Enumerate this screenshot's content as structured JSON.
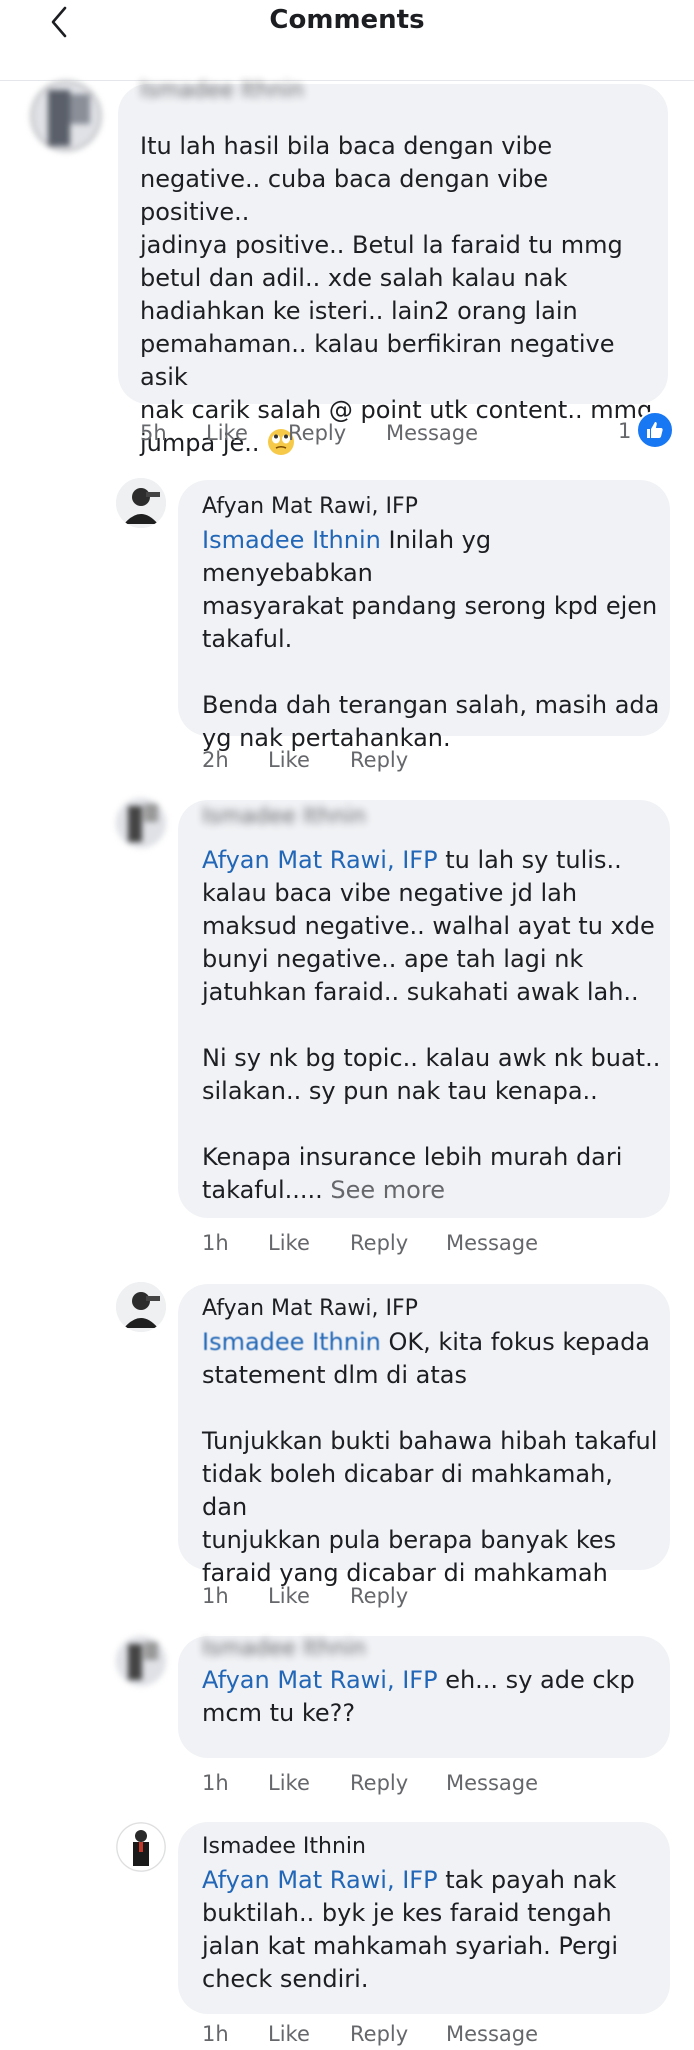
{
  "header": {
    "title": "Comments"
  },
  "comments": [
    {
      "author": "Ismadee Ithnin",
      "mention": "",
      "text": "Itu lah hasil bila baca dengan vibe\nnegative.. cuba baca dengan vibe positive..\njadinya positive.. Betul la faraid tu mmg\nbetul dan adil.. xde salah kalau nak\nhadiahkan ke isteri.. lain2 orang lain\npemahaman.. kalau berfikiran negative asik\nnak carik salah @ point utk content.. mmg\njumpa je..",
      "emoji": "rolling-eyes-emoji",
      "time": "5h",
      "like": "Like",
      "reply": "Reply",
      "message": "Message",
      "reaction_count": "1"
    },
    {
      "author": "Afyan Mat Rawi, IFP",
      "mention": "Ismadee Ithnin",
      "text": " Inilah yg menyebabkan\nmasyarakat pandang serong kpd ejen\ntakaful.\n\nBenda dah terangan salah, masih ada\nyg nak pertahankan.",
      "time": "2h",
      "like": "Like",
      "reply": "Reply"
    },
    {
      "author": "Ismadee Ithnin",
      "mention": "Afyan Mat Rawi, IFP",
      "text": " tu lah sy tulis..\nkalau baca vibe negative jd lah\nmaksud negative.. walhal ayat tu xde\nbunyi negative.. ape tah lagi nk\njatuhkan faraid.. sukahati awak lah..\n\nNi sy nk bg topic.. kalau awk nk buat..\nsilakan.. sy pun nak tau kenapa..\n\nKenapa insurance lebih murah dari\ntakaful.....",
      "see_more": " See more",
      "time": "1h",
      "like": "Like",
      "reply": "Reply",
      "message": "Message"
    },
    {
      "author": "Afyan Mat Rawi, IFP",
      "mention": "Ismadee Ithnin",
      "text": " OK, kita fokus kepada\nstatement dlm di atas\n\nTunjukkan bukti bahawa hibah takaful\ntidak boleh dicabar di mahkamah, dan\ntunjukkan pula berapa banyak kes\nfaraid yang dicabar di mahkamah",
      "time": "1h",
      "like": "Like",
      "reply": "Reply"
    },
    {
      "author": "Ismadee Ithnin",
      "mention": "Afyan Mat Rawi, IFP",
      "text": " eh... sy ade ckp\nmcm tu ke??",
      "time": "1h",
      "like": "Like",
      "reply": "Reply",
      "message": "Message"
    },
    {
      "author": "Ismadee Ithnin",
      "mention": "Afyan Mat Rawi, IFP",
      "text": " tak payah nak\nbuktilah.. byk je kes faraid tengah\njalan kat mahkamah syariah. Pergi\ncheck sendiri.",
      "time": "1h",
      "like": "Like",
      "reply": "Reply",
      "message": "Message"
    }
  ],
  "colors": {
    "bubble": "#f0f2f5",
    "mention": "#2267b7",
    "meta": "#65676b",
    "like_badge": "#1877f2"
  }
}
